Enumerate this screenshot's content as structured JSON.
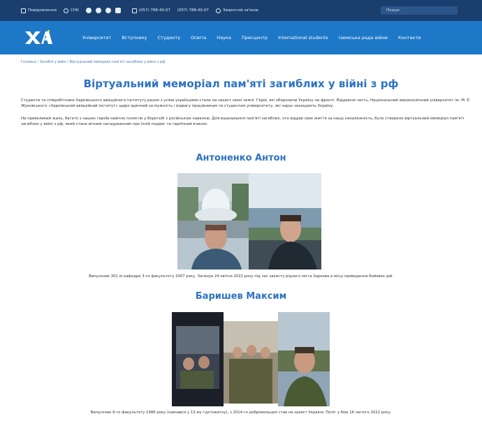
{
  "topbar": {
    "items": [
      "Повідомлення",
      "СНК",
      "(057) 788-40-07",
      "(057) 788-40-07",
      "Зворотній зв'язок"
    ],
    "search_placeholder": "Пошук"
  },
  "nav": {
    "logo_text": "ХАІ",
    "items": [
      "Університет",
      "Вступнику",
      "Студенту",
      "Освіта",
      "Наука",
      "Пресцентр",
      "International students",
      "Ізюмська рада війни",
      "Контакти"
    ]
  },
  "breadcrumb": [
    "Головна",
    "Загиблі у війні",
    "Віртуальний меморіал пам'яті загиблих у війні з рф"
  ],
  "page": {
    "title": "Віртуальний меморіал пам'яті загиблих у війні з рф",
    "intro_1": "Студенти та співробітники Харківського авіаційного інституту разом з усіма українцями стали на захист своєї землі. Герої, які оборонили Україну на фронті. Віддаючи честь, Національний аерокосмічний університет ім. М. Є. Жуковського «Харківський авіаційний інститут» щиро вдячний за мужність і відвагу працівникам та студентам університету, які зараз захищають Україну.",
    "intro_2": "На превеликий жаль, багато з наших героїв навічно полягли у боротьбі з російською навалою. Для вшанування пам'яті загиблих, хто віддав своє життя за нашу незалежність, було створено віртуальний меморіал пам'яті загиблих у війні з рф, який стане вічним нагадуванням про їхній подвиг та героїчний вчинок."
  },
  "heroes": [
    {
      "name": "Антоненко Антон",
      "caption": "Випускник 301 ої кафедри 3-го факультету 2007 року. Загинув 24 квітня 2022 року під час захисту рідного міста Харкова в місці проведення бойових дій."
    },
    {
      "name": "Баришев Максим",
      "caption": "Випускник 6-го факультету 1986 року (навчався у 13-му гуртожитку), з 2014-го добровольцем став на захист України. Поліг у бою 16 лютого 2022 року."
    }
  ],
  "colors": {
    "topbar": "#1a3f6e",
    "navbar": "#1e78c8",
    "title": "#2d73c2"
  }
}
